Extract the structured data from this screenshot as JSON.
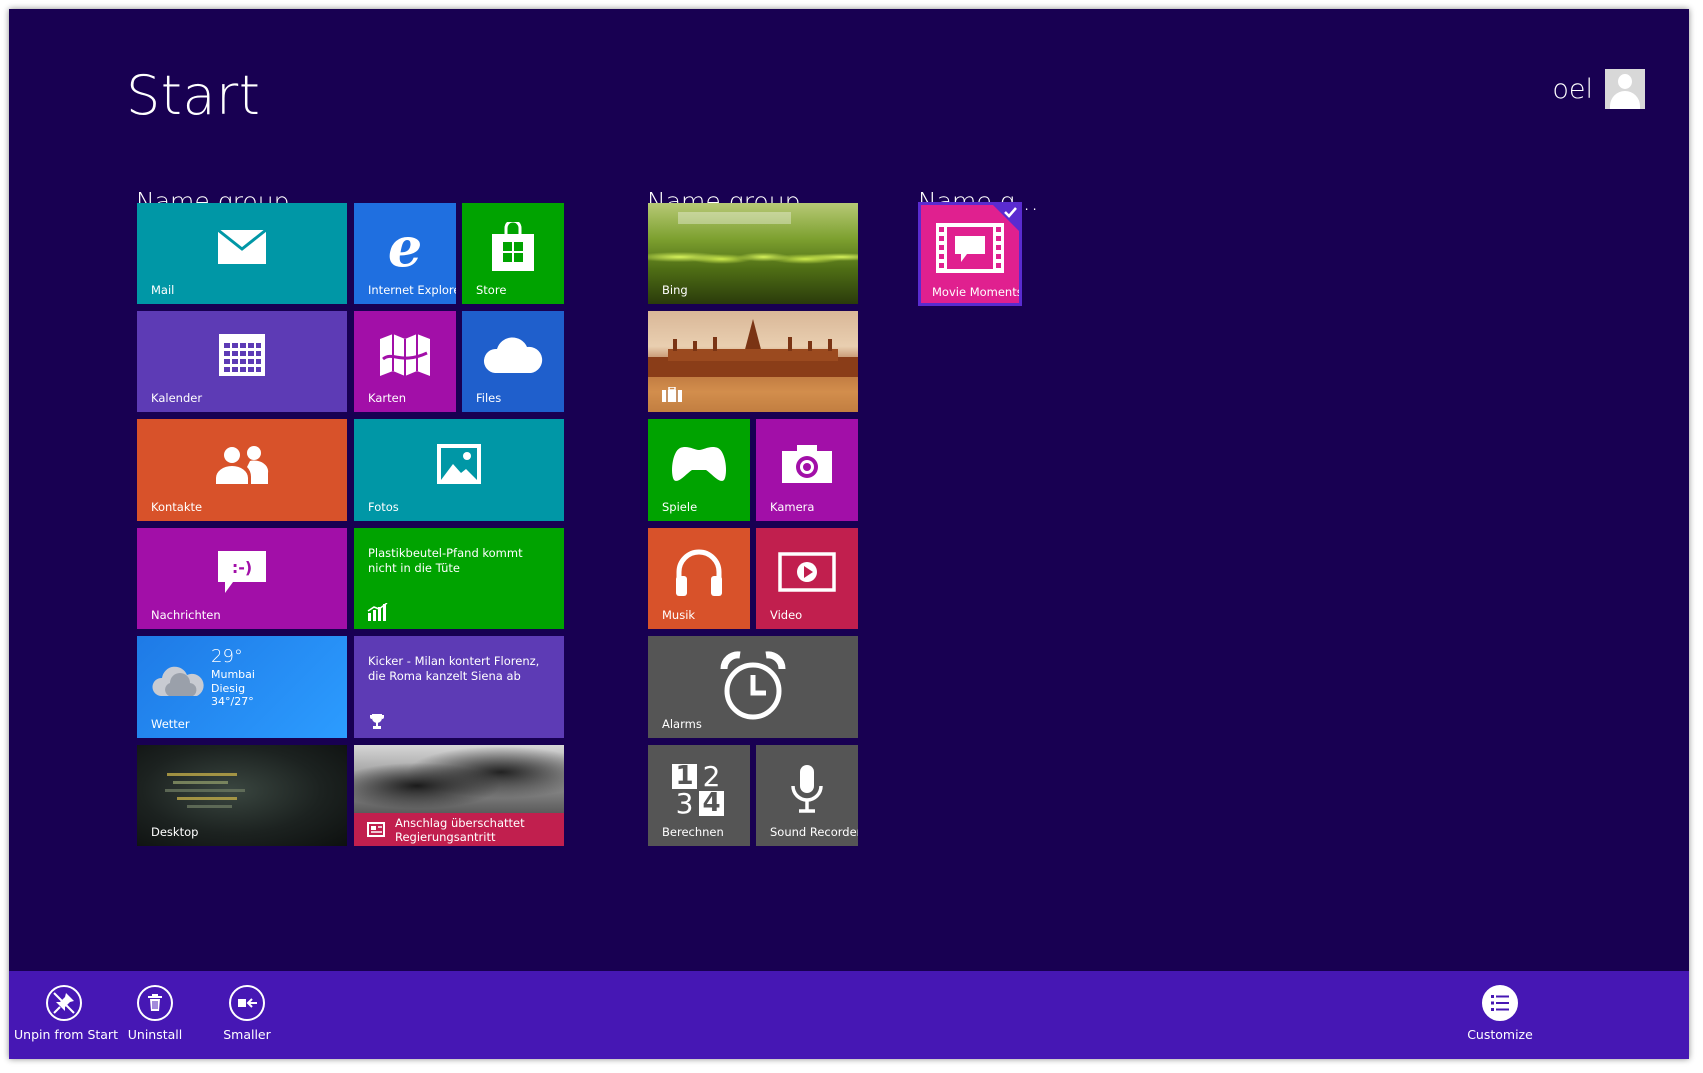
{
  "page": {
    "title": "Start"
  },
  "user": {
    "name": "oel"
  },
  "groups": [
    {
      "label": "Name group"
    },
    {
      "label": "Name group"
    },
    {
      "label": "Name g..."
    }
  ],
  "tiles": {
    "mail": {
      "label": "Mail"
    },
    "ie": {
      "label": "Internet Explorer"
    },
    "store": {
      "label": "Store"
    },
    "calendar": {
      "label": "Kalender"
    },
    "maps": {
      "label": "Karten"
    },
    "files": {
      "label": "Files"
    },
    "contacts": {
      "label": "Kontakte"
    },
    "photos": {
      "label": "Fotos"
    },
    "messages": {
      "label": "Nachrichten"
    },
    "finance": {
      "headline": "Plastikbeutel-Pfand kommt nicht in die Tüte"
    },
    "weather": {
      "label": "Wetter",
      "temp": "29°",
      "city": "Mumbai",
      "condition": "Diesig",
      "range": "34°/27°"
    },
    "sports": {
      "headline": "Kicker - Milan kontert Florenz, die Roma kanzelt Siena ab"
    },
    "desktop": {
      "label": "Desktop"
    },
    "news": {
      "headline": "Anschlag überschattet Regierungsantritt"
    },
    "bing": {
      "label": "Bing"
    },
    "travel": {
      "label": ""
    },
    "games": {
      "label": "Spiele"
    },
    "camera": {
      "label": "Kamera"
    },
    "music": {
      "label": "Musik"
    },
    "video": {
      "label": "Video"
    },
    "alarms": {
      "label": "Alarms"
    },
    "calculator": {
      "label": "Berechnen",
      "digits": [
        "1",
        "2",
        "3",
        "4"
      ]
    },
    "sound_recorder": {
      "label": "Sound Recorder"
    },
    "movie_moments": {
      "label": "Movie Moments",
      "selected": true
    }
  },
  "app_bar": {
    "unpin": "Unpin from Start",
    "uninstall": "Uninstall",
    "smaller": "Smaller",
    "customize": "Customize"
  },
  "colors": {
    "background": "#180052",
    "app_bar": "#4617b4",
    "teal": "#0097a6",
    "purple": "#5d3bb5",
    "magenta": "#a20fa8",
    "green": "#00a300",
    "blue": "#1f5fcc",
    "orange": "#d8522a",
    "crimson": "#c11f4e",
    "gray": "#555555",
    "pink": "#e0208f"
  }
}
